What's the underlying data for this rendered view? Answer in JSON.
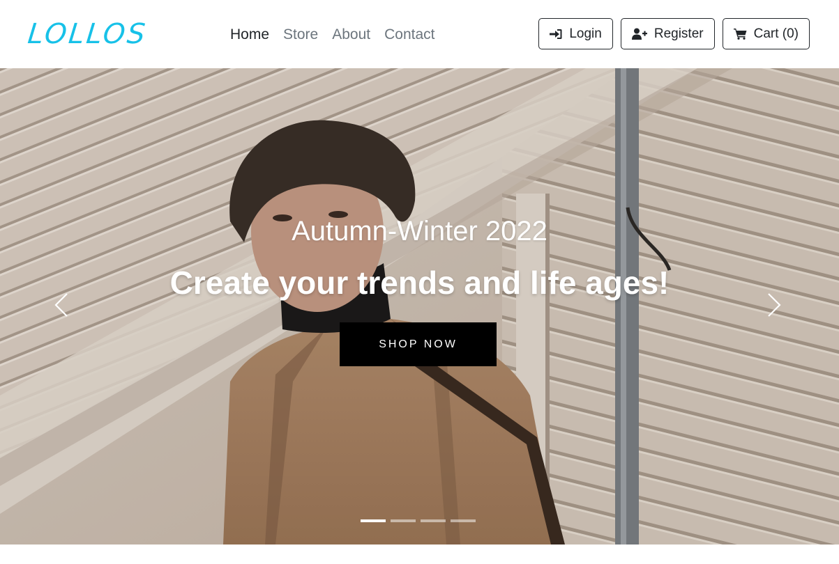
{
  "brand": {
    "name": "LOLLOS",
    "color": "#17c1e8"
  },
  "nav": {
    "links": [
      {
        "label": "Home",
        "active": true
      },
      {
        "label": "Store",
        "active": false
      },
      {
        "label": "About",
        "active": false
      },
      {
        "label": "Contact",
        "active": false
      }
    ]
  },
  "actions": {
    "login": {
      "label": "Login",
      "icon": "sign-in-icon"
    },
    "register": {
      "label": "Register",
      "icon": "user-plus-icon"
    },
    "cart": {
      "label": "Cart (0)",
      "icon": "shopping-cart-icon"
    }
  },
  "hero": {
    "subtitle": "Autumn-Winter 2022",
    "title": "Create your trends and life ages!",
    "cta_label": "SHOP NOW",
    "prev_icon": "chevron-left-icon",
    "next_icon": "chevron-right-icon",
    "slide_count": 4,
    "active_slide": 1
  },
  "colors": {
    "button_dark": "#000000",
    "text_dark": "#212529",
    "text_muted": "#6c757d"
  }
}
